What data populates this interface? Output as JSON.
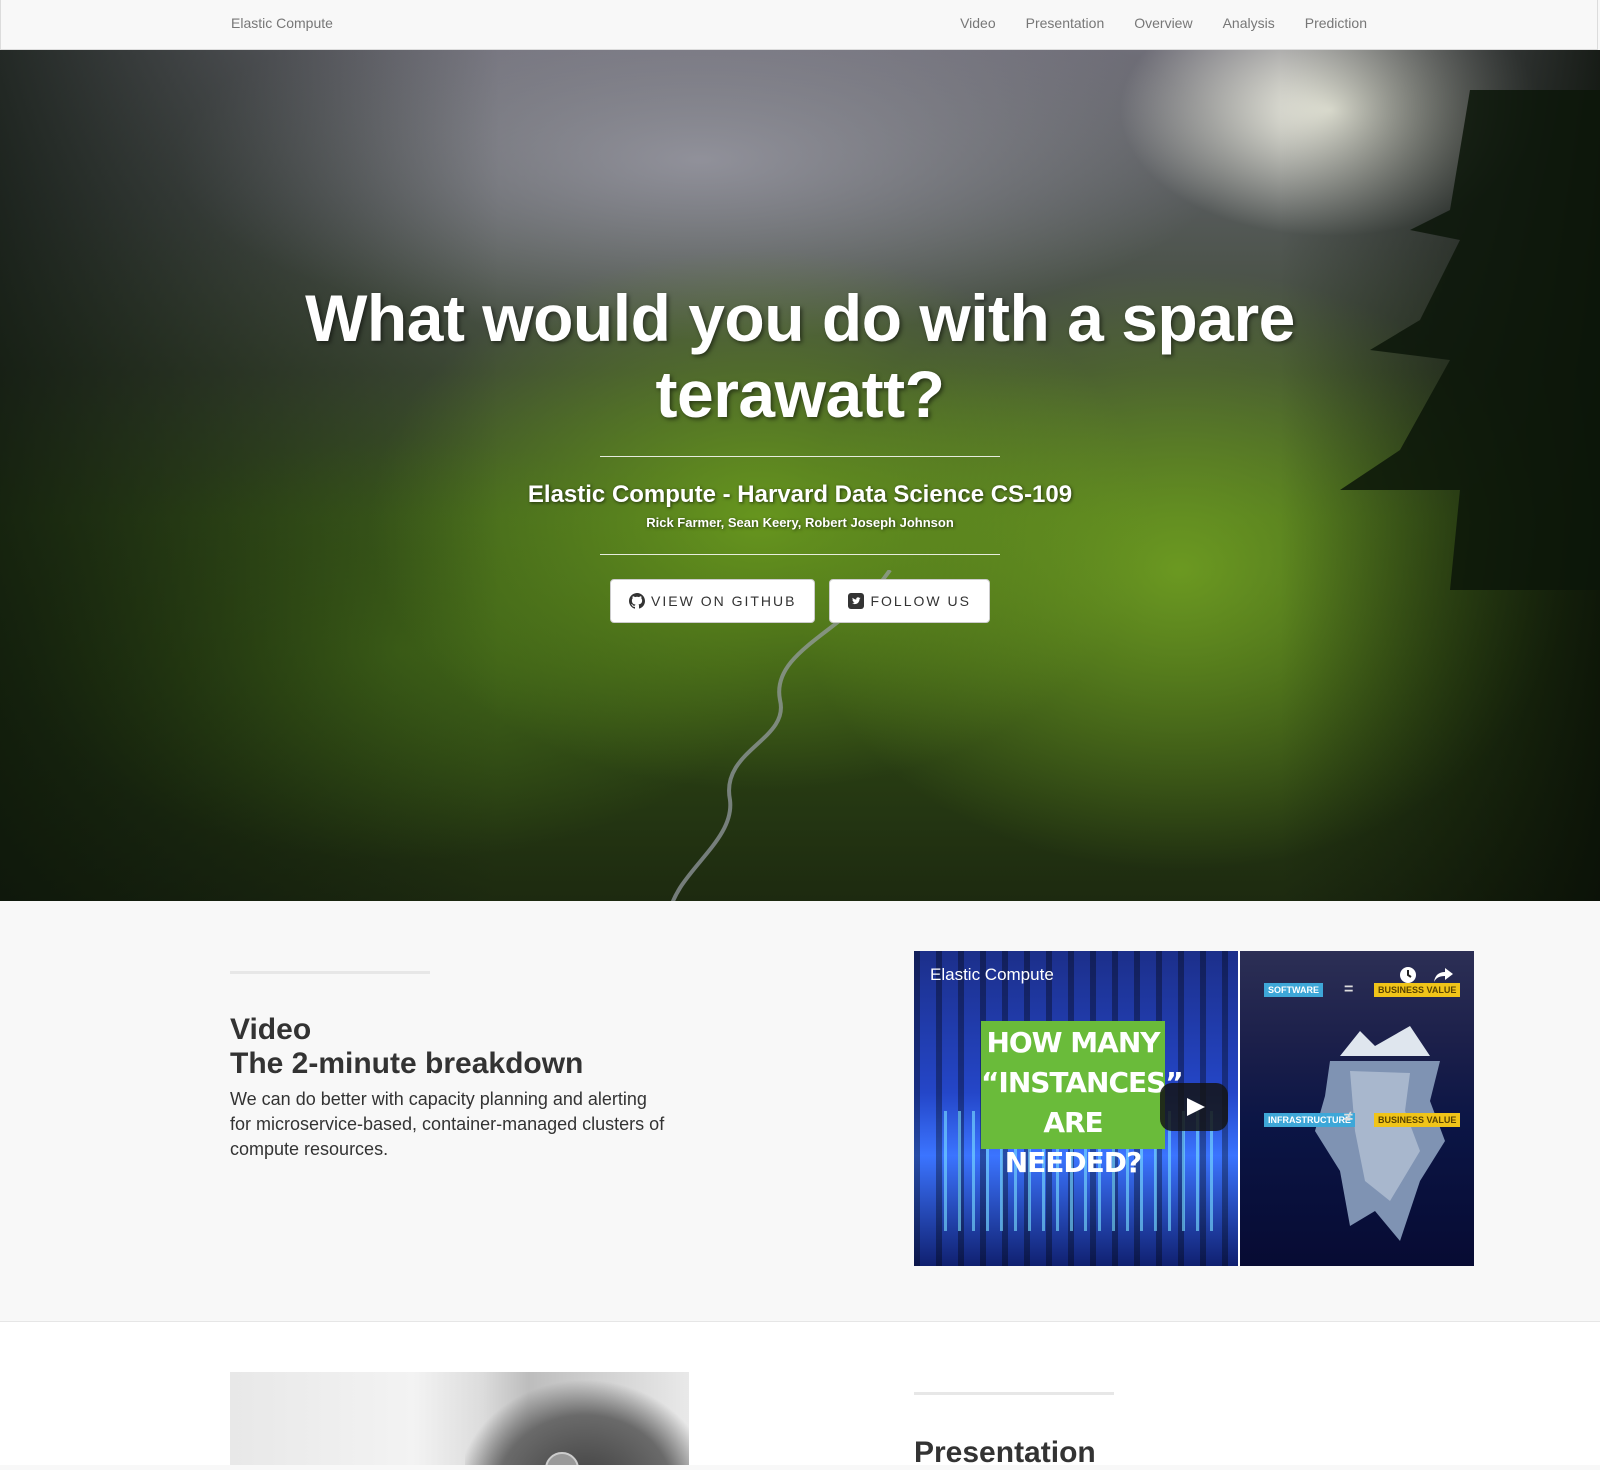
{
  "navbar": {
    "brand": "Elastic Compute",
    "links": [
      "Video",
      "Presentation",
      "Overview",
      "Analysis",
      "Prediction"
    ]
  },
  "hero": {
    "title_line1": "What would you do with a spare",
    "title_line2": "terawatt?",
    "subtitle": "Elastic Compute - Harvard Data Science CS-109",
    "authors": "Rick Farmer, Sean Keery, Robert Joseph Johnson",
    "buttons": [
      {
        "label": "View on GitHub",
        "icon": "github-icon"
      },
      {
        "label": "Follow Us",
        "icon": "twitter-square-icon"
      }
    ]
  },
  "video_section": {
    "heading_line1": "Video",
    "heading_line2": "The 2-minute breakdown",
    "lead": "We can do better with capacity planning and alerting for microservice-based, container-managed clusters of compute resources.",
    "thumbnail": {
      "title": "Elastic Compute",
      "headline_lines": [
        "HOW MANY",
        "“INSTANCES”",
        "ARE NEEDED?"
      ],
      "tags": {
        "software": "SOFTWARE",
        "business_value_top": "BUSINESS VALUE",
        "infrastructure": "INFRASTRUCTURE",
        "business_value_bottom": "BUSINESS VALUE"
      },
      "icons": [
        "clock-icon",
        "share-icon",
        "play-icon"
      ]
    }
  },
  "presentation_section": {
    "heading": "Presentation"
  },
  "colors": {
    "navbar_bg": "#f8f8f8",
    "section_bg": "#f8f8f8",
    "hero_text": "#ffffff",
    "thumb_green": "#6abb3a"
  }
}
